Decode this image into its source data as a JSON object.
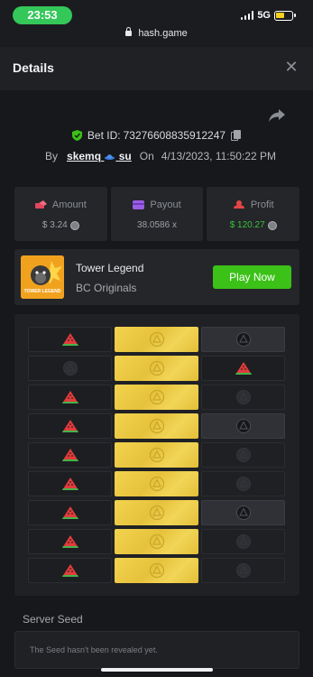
{
  "status_bar": {
    "time": "23:53",
    "network": "5G",
    "url": "hash.game"
  },
  "header": {
    "title": "Details",
    "close_label": "✕"
  },
  "bet": {
    "id_label": "Bet ID:",
    "id": "73276608835912247",
    "by_label": "By",
    "user": "skemq",
    "user_suffix": "su",
    "on_label": "On",
    "datetime": "4/13/2023, 11:50:22 PM"
  },
  "stats": {
    "amount": {
      "label": "Amount",
      "value": "$ 3.24"
    },
    "payout": {
      "label": "Payout",
      "value": "38.0586 x"
    },
    "profit": {
      "label": "Profit",
      "value": "$ 120.27"
    }
  },
  "game": {
    "thumb_text": "TOWER LEGEND",
    "name": "Tower Legend",
    "provider": "BC Originals",
    "play_label": "Play Now"
  },
  "grid": {
    "rows": [
      [
        "melon",
        "gold",
        "gray"
      ],
      [
        "dark",
        "gold",
        "melon"
      ],
      [
        "melon",
        "gold",
        "fade"
      ],
      [
        "melon",
        "gold",
        "gray"
      ],
      [
        "melon",
        "gold",
        "fade"
      ],
      [
        "melon",
        "gold",
        "fade"
      ],
      [
        "melon",
        "gold",
        "gray"
      ],
      [
        "melon",
        "gold",
        "fade"
      ],
      [
        "melon",
        "gold",
        "fade"
      ]
    ]
  },
  "seed": {
    "label": "Server Seed",
    "text": "The Seed hasn't been revealed yet."
  },
  "colors": {
    "accent_green": "#3bc117",
    "profit_green": "#3cc13b",
    "gold": "#f3d34e",
    "background": "#17181b"
  }
}
